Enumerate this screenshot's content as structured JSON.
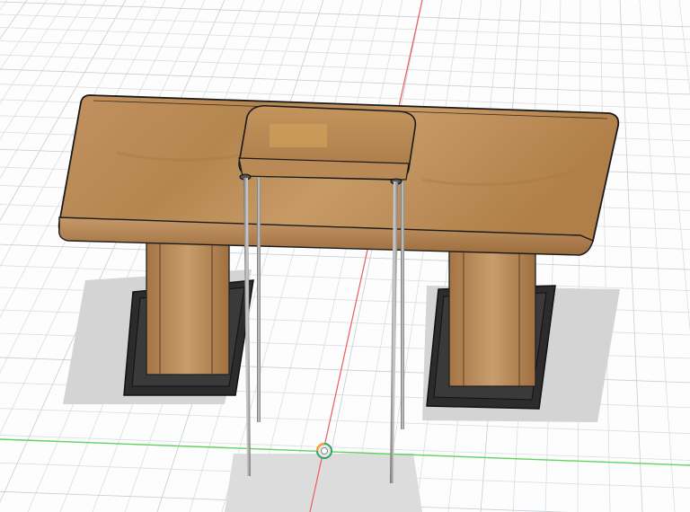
{
  "viewport": {
    "background": "#fdfdfd",
    "grid_color": "#d9dde2",
    "grid_major_color": "#c6ccd3"
  },
  "axes": {
    "x_axis_color": "#5fd35f",
    "y_axis_color": "#ef5a5a"
  },
  "model": {
    "wood_color": "#b88a55",
    "wood_dark": "#8c6234",
    "base_color": "#2c2c2c",
    "shadow_color": "#d3d3d3",
    "leg_color": "#8a8a8a"
  },
  "origin_marker": {
    "icon": "origin-pivot-icon",
    "color_a": "#2fa36b",
    "color_b": "#f1a23a"
  }
}
